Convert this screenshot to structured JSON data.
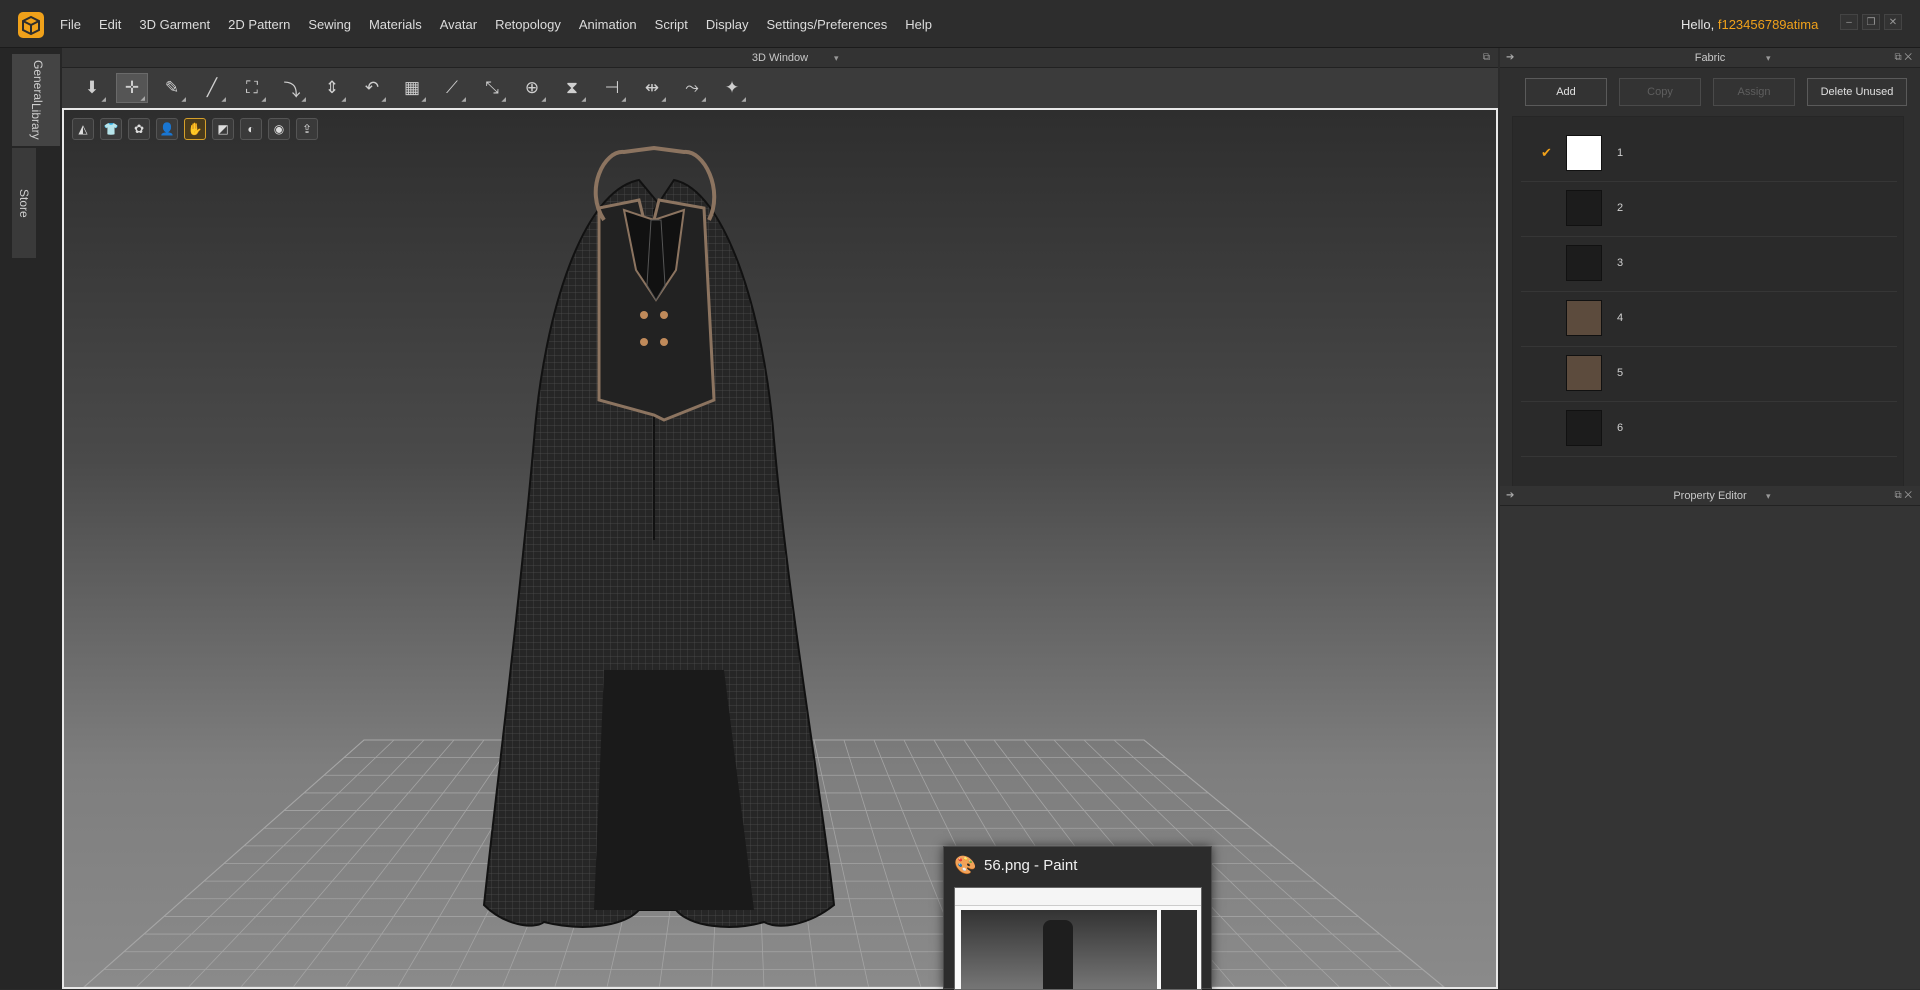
{
  "menubar": {
    "items": [
      "File",
      "Edit",
      "3D Garment",
      "2D Pattern",
      "Sewing",
      "Materials",
      "Avatar",
      "Retopology",
      "Animation",
      "Script",
      "Display",
      "Settings/Preferences",
      "Help"
    ],
    "greeting": "Hello, ",
    "username": "f123456789atima"
  },
  "sidebar": {
    "tabs": [
      "Library",
      "General",
      "Store"
    ]
  },
  "window3d": {
    "title": "3D Window"
  },
  "toolbar": {
    "tools": [
      "simulate-icon",
      "select-move-icon",
      "pin-icon",
      "measure-icon",
      "garment-fit-icon",
      "transform-icon",
      "avatar-measure-icon",
      "fold-icon",
      "grid-icon",
      "sewing-icon",
      "segment-icon",
      "pin-box-icon",
      "zipper-icon",
      "cut-icon",
      "button-icon",
      "lay-out-icon",
      "walk-icon"
    ]
  },
  "viewport": {
    "tools": [
      "texture-toggle-icon",
      "garment-show-icon",
      "rigging-icon",
      "avatar-show-icon",
      "hand-icon",
      "fabric-view-icon",
      "profile-view-icon",
      "surface-icon",
      "export-icon"
    ]
  },
  "fabric_panel": {
    "title": "Fabric",
    "buttons": {
      "add": "Add",
      "copy": "Copy",
      "assign": "Assign",
      "delete_unused": "Delete Unused"
    },
    "items": [
      {
        "label": "1",
        "color": "#ffffff",
        "selected": true
      },
      {
        "label": "2",
        "color": "#1c1c1c",
        "selected": false
      },
      {
        "label": "3",
        "color": "#1c1c1c",
        "selected": false
      },
      {
        "label": "4",
        "color": "#5c4b3d",
        "selected": false
      },
      {
        "label": "5",
        "color": "#5c4b3d",
        "selected": false
      },
      {
        "label": "6",
        "color": "#1c1c1c",
        "selected": false
      }
    ]
  },
  "property_editor": {
    "title": "Property Editor"
  },
  "taskbar_preview": {
    "title": "56.png - Paint"
  },
  "colors": {
    "accent": "#f0a11a",
    "viewport_border": "#e8e8e8"
  }
}
